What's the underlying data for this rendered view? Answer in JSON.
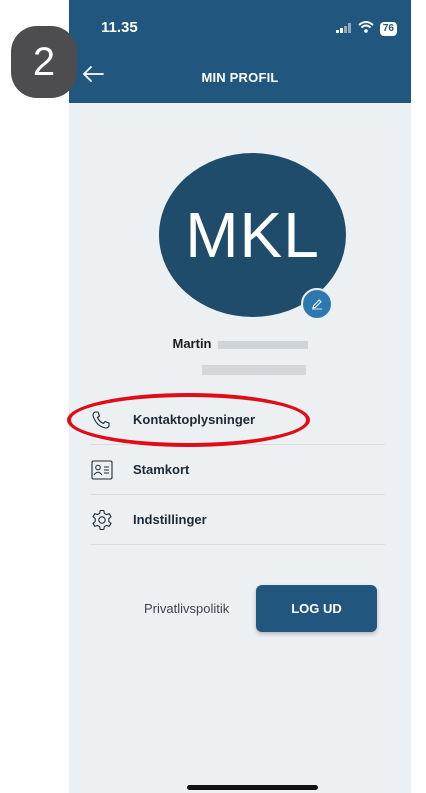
{
  "badge": {
    "step": "2"
  },
  "status_bar": {
    "time": "11.35",
    "battery": "76"
  },
  "header": {
    "title": "MIN PROFIL"
  },
  "profile": {
    "initials": "MKL",
    "first_name": "Martin"
  },
  "menu": {
    "items": [
      {
        "label": "Kontaktoplysninger",
        "icon": "phone-icon"
      },
      {
        "label": "Stamkort",
        "icon": "id-card-icon"
      },
      {
        "label": "Indstillinger",
        "icon": "gear-icon"
      }
    ]
  },
  "footer": {
    "privacy_label": "Privatlivspolitik",
    "logout_label": "LOG UD"
  },
  "colors": {
    "header": "#21577f",
    "avatar": "#1f4c6b",
    "highlight": "#e00d18",
    "background": "#edf0f3"
  }
}
